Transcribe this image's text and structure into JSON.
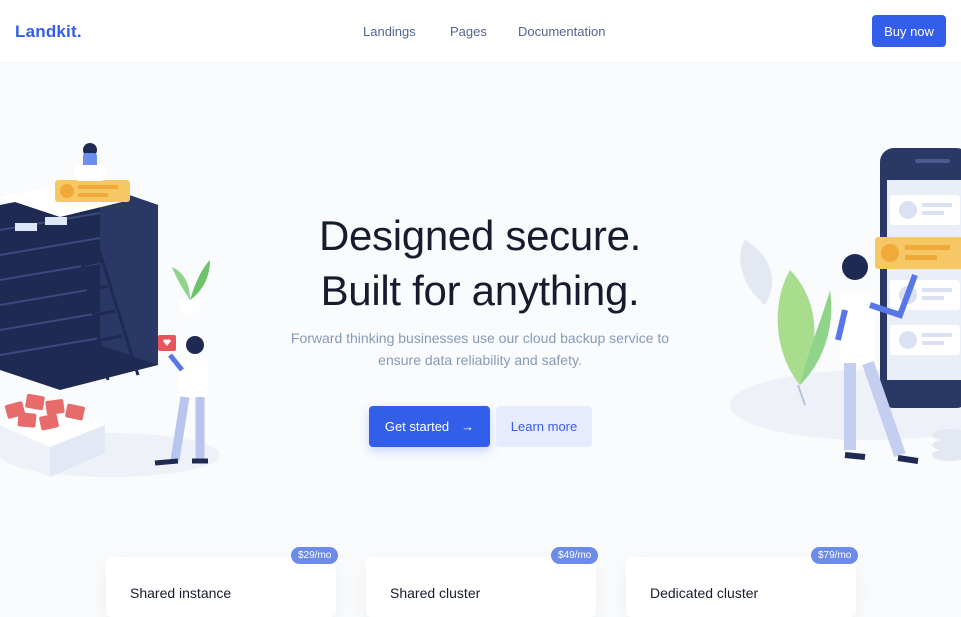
{
  "brand": {
    "name": "Landkit."
  },
  "nav": {
    "items": [
      {
        "label": "Landings"
      },
      {
        "label": "Pages"
      },
      {
        "label": "Documentation"
      }
    ],
    "cta_label": "Buy now"
  },
  "hero": {
    "title_line1": "Designed secure.",
    "title_line2": "Built for anything.",
    "subtitle": "Forward thinking businesses use our cloud backup service to ensure data reliability and safety.",
    "primary_label": "Get started",
    "primary_icon": "arrow-right-icon",
    "secondary_label": "Learn more"
  },
  "pricing": {
    "cards": [
      {
        "name": "Shared instance",
        "price": "$29/mo"
      },
      {
        "name": "Shared cluster",
        "price": "$49/mo"
      },
      {
        "name": "Dedicated cluster",
        "price": "$79/mo"
      }
    ]
  },
  "colors": {
    "primary": "#335eea",
    "primary_soft": "#e6ecfd",
    "text_dark": "#161c2d",
    "text_muted": "#869ab8",
    "nav_text": "#506690",
    "badge": "#6d8be8"
  }
}
